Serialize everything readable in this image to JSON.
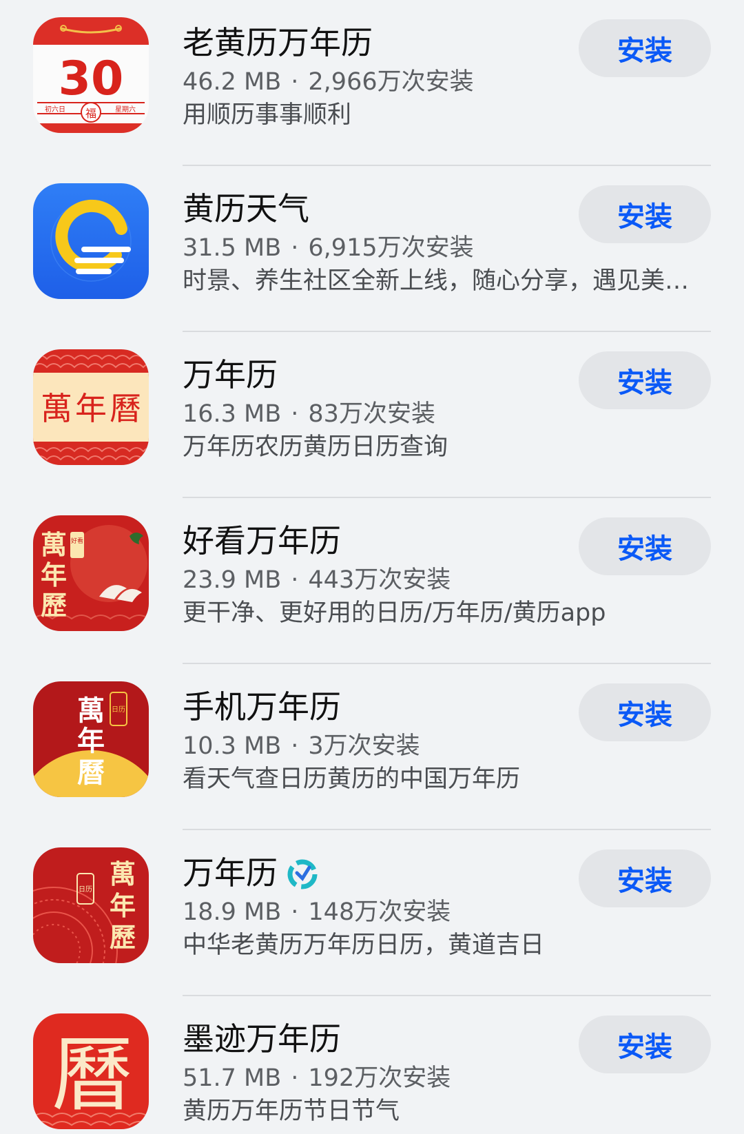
{
  "apps": [
    {
      "name": "老黄历万年历",
      "size": "46.2 MB",
      "separator": "·",
      "installs": "2,966万次安装",
      "description": "用顺历事事顺利",
      "button": "安装",
      "icon": "calendar-30-icon",
      "icon_texts": {
        "day": "30",
        "left": "初六日",
        "right": "星期六",
        "fu": "福"
      }
    },
    {
      "name": "黄历天气",
      "size": "31.5 MB",
      "separator": "·",
      "installs": "6,915万次安装",
      "description": "时景、养生社区全新上线，随心分享，遇见美…",
      "button": "安装",
      "icon": "sun-cloud-icon"
    },
    {
      "name": "万年历",
      "size": "16.3 MB",
      "separator": "·",
      "installs": "83万次安装",
      "description": "万年历农历黄历日历查询",
      "button": "安装",
      "icon": "wannianli-seal-icon",
      "icon_texts": {
        "t1": "萬",
        "t2": "年",
        "t3": "曆"
      }
    },
    {
      "name": "好看万年历",
      "size": "23.9 MB",
      "separator": "·",
      "installs": "443万次安装",
      "description": "更干净、更好用的日历/万年历/黄历app",
      "button": "安装",
      "icon": "crane-calendar-icon",
      "icon_texts": {
        "t1": "萬",
        "t2": "年",
        "t3": "歷",
        "tag": "好看"
      }
    },
    {
      "name": "手机万年历",
      "size": "10.3 MB",
      "separator": "·",
      "installs": "3万次安装",
      "description": "看天气查日历黄历的中国万年历",
      "button": "安装",
      "icon": "sunrise-calendar-icon",
      "icon_texts": {
        "t1": "萬",
        "t2": "年",
        "t3": "曆",
        "tag": "日历"
      }
    },
    {
      "name": "万年历",
      "size": "18.9 MB",
      "separator": "·",
      "installs": "148万次安装",
      "description": "中华老黄历万年历日历，黄道吉日",
      "button": "安装",
      "icon": "compass-calendar-icon",
      "badge_icon": "verified-badge-icon",
      "icon_texts": {
        "t1": "萬",
        "t2": "年",
        "t3": "歷",
        "tag": "日历"
      }
    },
    {
      "name": "墨迹万年历",
      "size": "51.7 MB",
      "separator": "·",
      "installs": "192万次安装",
      "description": "黄历万年历节日节气",
      "button": "安装",
      "icon": "calligraphy-li-icon",
      "icon_texts": {
        "t1": "曆"
      }
    }
  ],
  "colors": {
    "accent": "#0a59f7",
    "background": "#f1f3f5",
    "button_bg": "#e3e5e8",
    "icon_red": "#d42a22"
  }
}
